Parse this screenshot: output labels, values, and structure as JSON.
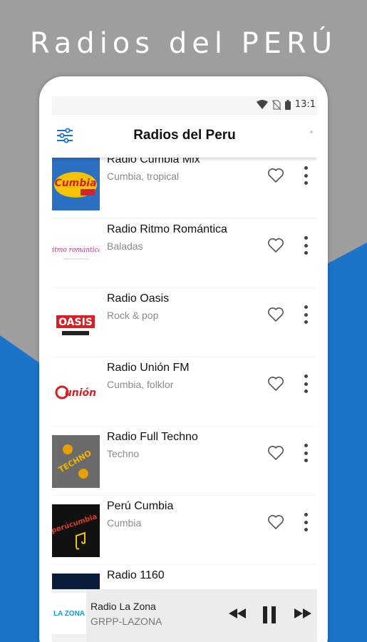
{
  "promo": {
    "title": "Radios del PERÚ"
  },
  "status": {
    "time": "13:1"
  },
  "appbar": {
    "title": "Radios del Peru"
  },
  "stations": [
    {
      "name": "Radio Cumbia Mix",
      "genre": "Cumbia, tropical",
      "logo_text": "Cumbia"
    },
    {
      "name": "Radio Ritmo Romántica",
      "genre": "Baladas",
      "logo_text": "ritmo romántica"
    },
    {
      "name": "Radio Oasis",
      "genre": "Rock & pop",
      "logo_text": "OASIS"
    },
    {
      "name": "Radio Unión FM",
      "genre": "Cumbia, folklor",
      "logo_text": "unión"
    },
    {
      "name": "Radio Full Techno",
      "genre": "Techno",
      "logo_text": "TECHNO"
    },
    {
      "name": " Perú Cumbia",
      "genre": "Cumbia",
      "logo_text": "perúcumbia"
    },
    {
      "name": "Radio 1160",
      "genre": "",
      "logo_text": ""
    }
  ],
  "player": {
    "station": "Radio La Zona",
    "subtitle": "GRPP-LAZONA",
    "logo_text": "LA ZONA"
  },
  "colors": {
    "accent_blue": "#1a74c9",
    "background_gray": "#9e9e9e"
  }
}
